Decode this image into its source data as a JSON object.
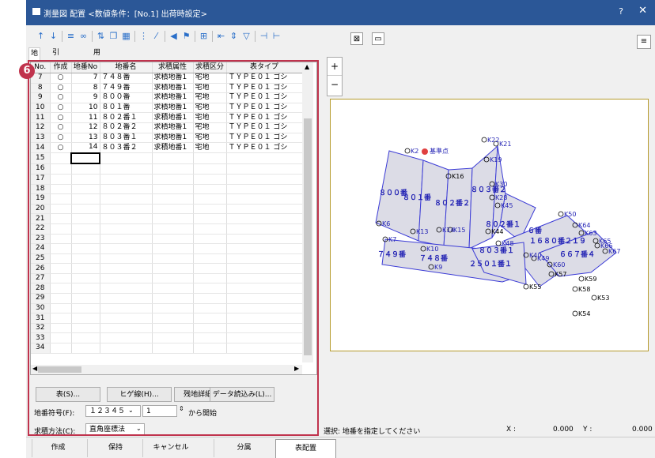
{
  "title": {
    "app_icon": "window-icon",
    "text": "測量図 配置 <数値条件：[No.1] 出荷時設定>",
    "help": "?",
    "close": "✕"
  },
  "tabs": [
    "地番",
    "引照境界",
    "用紙割付"
  ],
  "badge": "6",
  "grid": {
    "headers": [
      "No.",
      "作成",
      "地番No",
      "地番名",
      "求積属性",
      "求積区分",
      "表タイプ"
    ],
    "rows": [
      [
        "7",
        "○",
        "7",
        "７４８番",
        "求積地番1",
        "宅地",
        "ＴＹＰＥ０１ ゴシ"
      ],
      [
        "8",
        "○",
        "8",
        "７４９番",
        "求積地番1",
        "宅地",
        "ＴＹＰＥ０１ ゴシ"
      ],
      [
        "9",
        "○",
        "9",
        "８００番",
        "求積地番1",
        "宅地",
        "ＴＹＰＥ０１ ゴシ"
      ],
      [
        "10",
        "○",
        "10",
        "８０１番",
        "求積地番1",
        "宅地",
        "ＴＹＰＥ０１ ゴシ"
      ],
      [
        "11",
        "○",
        "11",
        "８０２番１",
        "求積地番1",
        "宅地",
        "ＴＹＰＥ０１ ゴシ"
      ],
      [
        "12",
        "○",
        "12",
        "８０２番２",
        "求積地番1",
        "宅地",
        "ＴＹＰＥ０１ ゴシ"
      ],
      [
        "13",
        "○",
        "13",
        "８０３番１",
        "求積地番1",
        "宅地",
        "ＴＹＰＥ０１ ゴシ"
      ],
      [
        "14",
        "○",
        "14",
        "８０３番２",
        "求積地番1",
        "宅地",
        "ＴＹＰＥ０１ ゴシ"
      ],
      [
        "15",
        "",
        "",
        "",
        "",
        "",
        ""
      ],
      [
        "16",
        "",
        "",
        "",
        "",
        "",
        ""
      ],
      [
        "17",
        "",
        "",
        "",
        "",
        "",
        ""
      ],
      [
        "18",
        "",
        "",
        "",
        "",
        "",
        ""
      ],
      [
        "19",
        "",
        "",
        "",
        "",
        "",
        ""
      ],
      [
        "20",
        "",
        "",
        "",
        "",
        "",
        ""
      ],
      [
        "21",
        "",
        "",
        "",
        "",
        "",
        ""
      ],
      [
        "22",
        "",
        "",
        "",
        "",
        "",
        ""
      ],
      [
        "23",
        "",
        "",
        "",
        "",
        "",
        ""
      ],
      [
        "24",
        "",
        "",
        "",
        "",
        "",
        ""
      ],
      [
        "25",
        "",
        "",
        "",
        "",
        "",
        ""
      ],
      [
        "26",
        "",
        "",
        "",
        "",
        "",
        ""
      ],
      [
        "27",
        "",
        "",
        "",
        "",
        "",
        ""
      ],
      [
        "28",
        "",
        "",
        "",
        "",
        "",
        ""
      ],
      [
        "29",
        "",
        "",
        "",
        "",
        "",
        ""
      ],
      [
        "30",
        "",
        "",
        "",
        "",
        "",
        ""
      ],
      [
        "31",
        "",
        "",
        "",
        "",
        "",
        ""
      ],
      [
        "32",
        "",
        "",
        "",
        "",
        "",
        ""
      ],
      [
        "33",
        "",
        "",
        "",
        "",
        "",
        ""
      ],
      [
        "34",
        "",
        "",
        "",
        "",
        "",
        ""
      ]
    ]
  },
  "buttons": {
    "table": "表(S)...",
    "hige": "ヒゲ線(H)...",
    "zanchi": "残地詳細(Z)...",
    "dataload": "データ読込み(L)..."
  },
  "chiban_label": "地番符号(F):",
  "chiban_value": "１２３４５",
  "start_value": "1",
  "start_suffix": "から開始",
  "method_label": "求積方法(C):",
  "method_value": "直角座標法",
  "status": {
    "select": "選択: 地番を指定してください",
    "x_label": "X :",
    "x_value": "0.000",
    "y_label": "Y :",
    "y_value": "0.000"
  },
  "bottom_buttons": [
    "作成",
    "保持",
    "キャンセル",
    "分属",
    "表配置"
  ],
  "map_labels": {
    "lots": [
      "８００番",
      "８０１番",
      "８０２番２",
      "８０３番２",
      "８０２番１",
      "８０３番１",
      "７４９番",
      "７４８番",
      "２５０１番１",
      "１６８０番２１９",
      "６６７番４",
      "６番"
    ],
    "points": [
      "K22",
      "K21",
      "K19",
      "K2",
      "K30",
      "K28",
      "K45",
      "K50",
      "K64",
      "K63",
      "K65",
      "K66",
      "K67",
      "K6",
      "K13",
      "K15",
      "K14",
      "K7",
      "K10",
      "K9",
      "K48",
      "K40",
      "K49",
      "K60",
      "K57",
      "K59",
      "K58",
      "K53",
      "K54",
      "K55",
      "K16",
      "K44"
    ],
    "origin": "基準点"
  }
}
